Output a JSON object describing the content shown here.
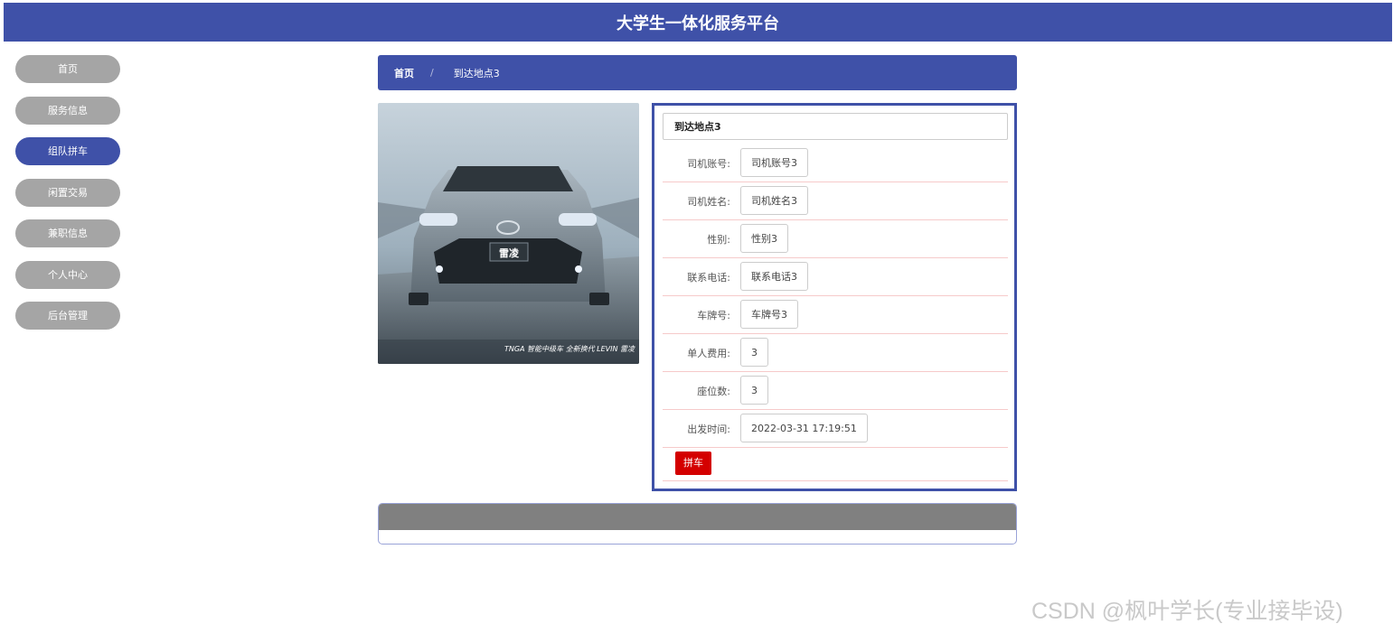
{
  "header": {
    "title": "大学生一体化服务平台"
  },
  "sidebar": {
    "items": [
      {
        "label": "首页"
      },
      {
        "label": "服务信息"
      },
      {
        "label": "组队拼车"
      },
      {
        "label": "闲置交易"
      },
      {
        "label": "兼职信息"
      },
      {
        "label": "个人中心"
      },
      {
        "label": "后台管理"
      }
    ],
    "active_index": 2
  },
  "breadcrumb": {
    "home": "首页",
    "separator": "/",
    "current": "到达地点3"
  },
  "photo": {
    "caption": "TNGA 智能中级车 全新换代 LEVIN 雷凌",
    "badge": "雷凌"
  },
  "detail": {
    "title": "到达地点3",
    "fields": [
      {
        "label": "司机账号:",
        "value": "司机账号3"
      },
      {
        "label": "司机姓名:",
        "value": "司机姓名3"
      },
      {
        "label": "性别:",
        "value": "性别3"
      },
      {
        "label": "联系电话:",
        "value": "联系电话3"
      },
      {
        "label": "车牌号:",
        "value": "车牌号3"
      },
      {
        "label": "单人费用:",
        "value": "3"
      },
      {
        "label": "座位数:",
        "value": "3"
      },
      {
        "label": "出发时间:",
        "value": "2022-03-31 17:19:51"
      }
    ],
    "action_label": "拼车"
  },
  "watermark": "CSDN @枫叶学长(专业接毕设)",
  "colors": {
    "primary": "#3f51a8",
    "nav_inactive": "#a5a5a5",
    "action": "#d40000",
    "row_divider": "#f6caca"
  }
}
